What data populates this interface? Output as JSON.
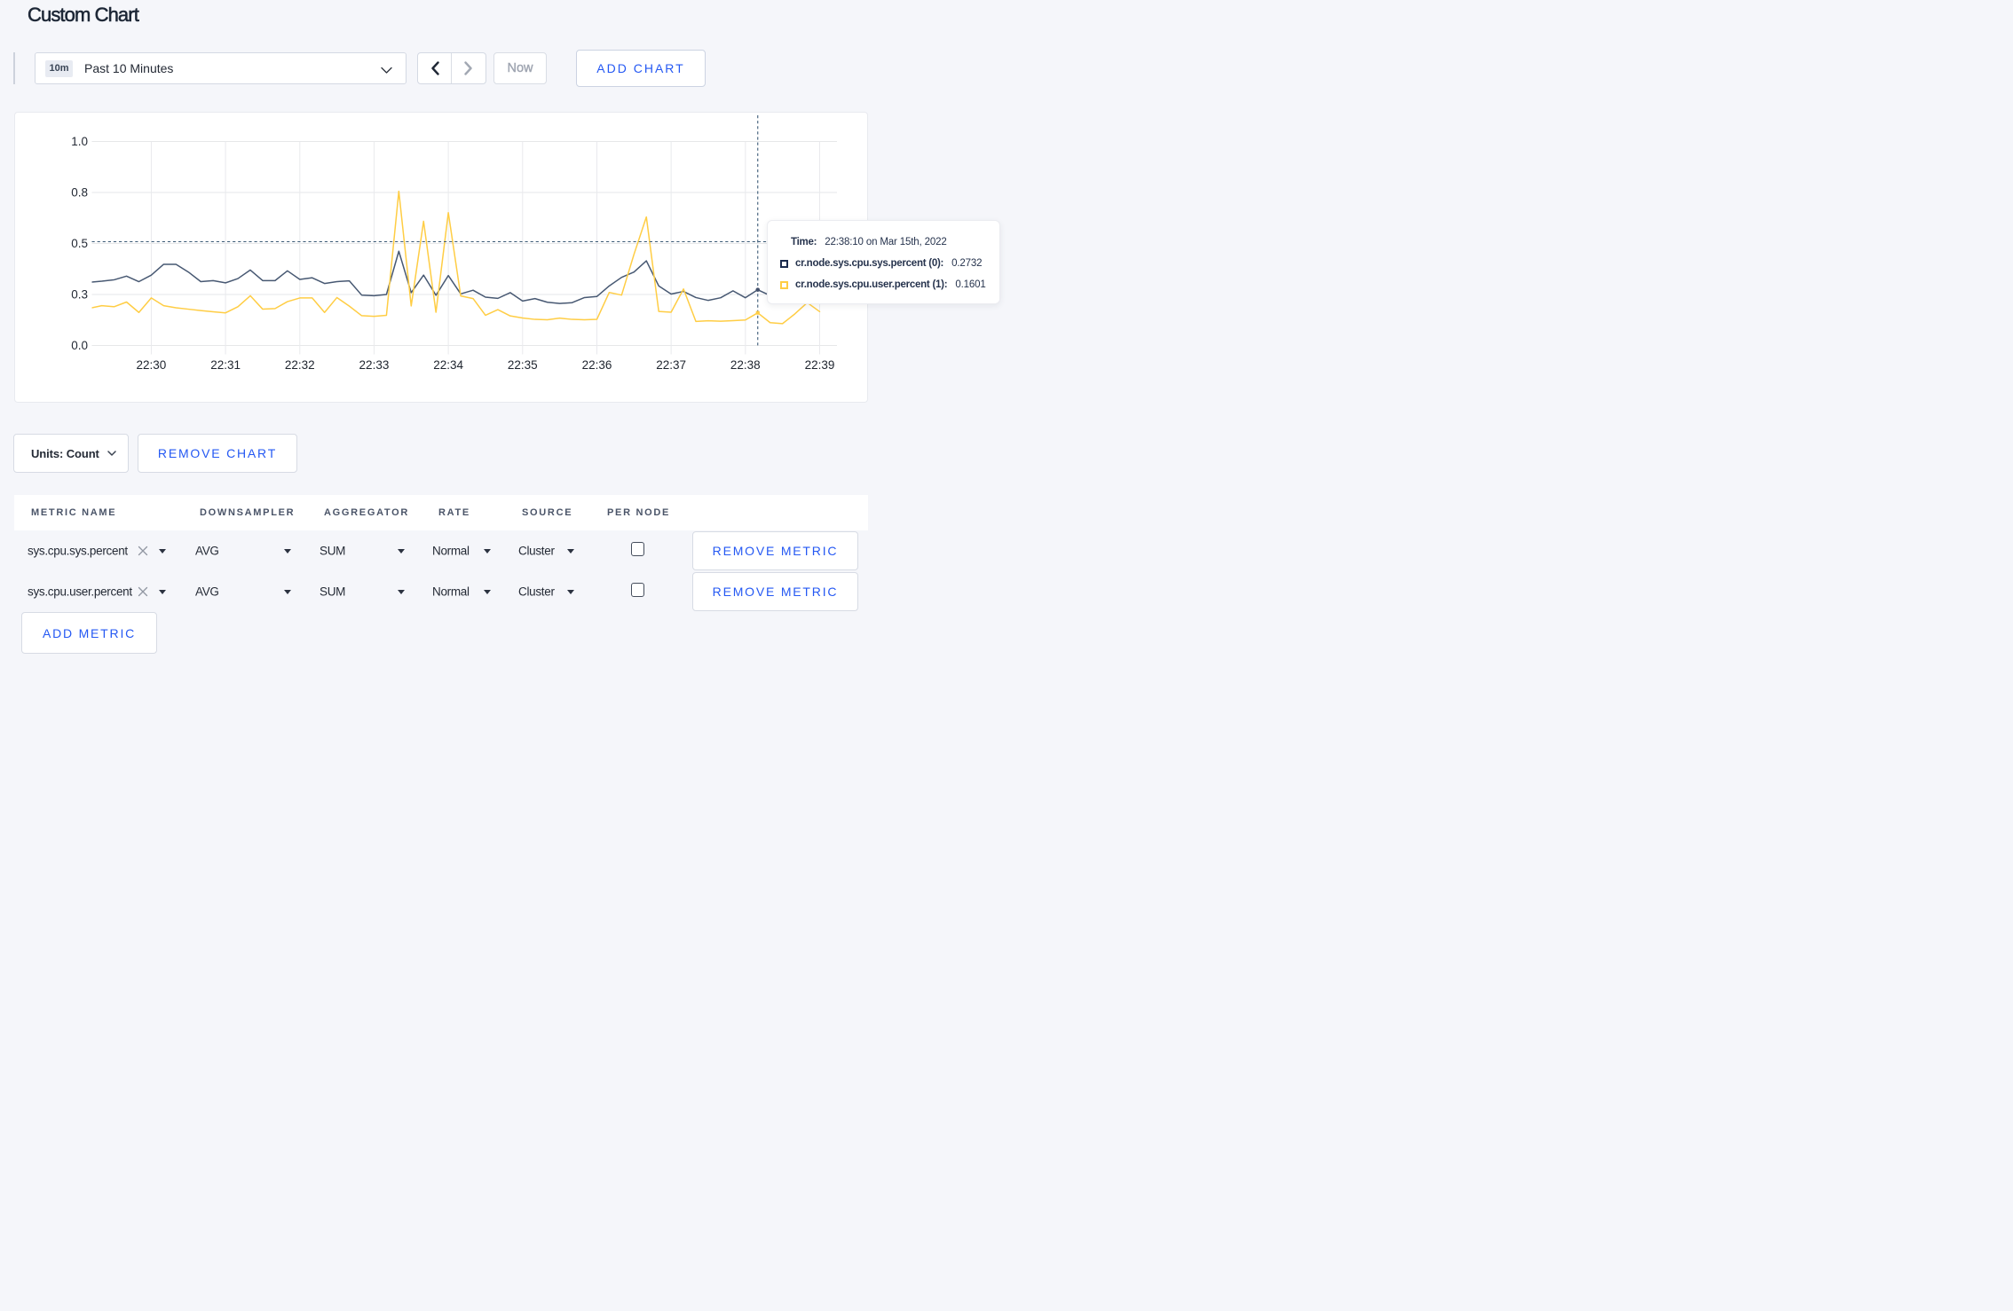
{
  "title": "Custom Chart",
  "toolbar": {
    "time_range_badge": "10m",
    "time_range_label": "Past 10 Minutes",
    "prev_icon": "chevron-left",
    "next_icon": "chevron-right",
    "now_label": "Now",
    "add_chart_label": "ADD CHART"
  },
  "chart_data": {
    "type": "line",
    "title": "",
    "xlabel": "",
    "ylabel": "",
    "ylim": [
      0,
      1.0
    ],
    "grid": true,
    "legend_position": "tooltip",
    "y_tick_labels": [
      "1.0",
      "0.8",
      "0.5",
      "0.3",
      "0.0"
    ],
    "y_tick_values": [
      1.0,
      0.75,
      0.5,
      0.25,
      0.0
    ],
    "x_tick_labels": [
      "22:30",
      "22:31",
      "22:32",
      "22:33",
      "22:34",
      "22:35",
      "22:36",
      "22:37",
      "22:38",
      "22:39"
    ],
    "x_domain": [
      "22:29:12",
      "22:39:14"
    ],
    "sample_interval_seconds": 10,
    "series": [
      {
        "name": "cr.node.sys.cpu.sys.percent (0)",
        "color": "#475872",
        "start_time": "22:29:10",
        "values": [
          0.31,
          0.315,
          0.322,
          0.34,
          0.313,
          0.345,
          0.398,
          0.398,
          0.36,
          0.313,
          0.318,
          0.307,
          0.328,
          0.37,
          0.318,
          0.318,
          0.366,
          0.324,
          0.332,
          0.304,
          0.313,
          0.317,
          0.247,
          0.244,
          0.25,
          0.462,
          0.259,
          0.345,
          0.246,
          0.343,
          0.253,
          0.271,
          0.237,
          0.231,
          0.259,
          0.218,
          0.23,
          0.212,
          0.206,
          0.21,
          0.235,
          0.24,
          0.292,
          0.334,
          0.36,
          0.415,
          0.292,
          0.252,
          0.265,
          0.235,
          0.221,
          0.234,
          0.268,
          0.234,
          0.2732,
          0.245,
          0.238,
          0.255,
          0.248,
          0.24
        ]
      },
      {
        "name": "cr.node.sys.cpu.user.percent (1)",
        "color": "#FFCD44",
        "start_time": "22:29:10",
        "values": [
          0.182,
          0.195,
          0.19,
          0.213,
          0.162,
          0.233,
          0.195,
          0.185,
          0.178,
          0.171,
          0.165,
          0.16,
          0.19,
          0.244,
          0.178,
          0.181,
          0.215,
          0.233,
          0.233,
          0.162,
          0.235,
          0.193,
          0.146,
          0.143,
          0.148,
          0.756,
          0.194,
          0.609,
          0.163,
          0.651,
          0.243,
          0.23,
          0.148,
          0.176,
          0.145,
          0.135,
          0.128,
          0.126,
          0.134,
          0.128,
          0.126,
          0.128,
          0.26,
          0.247,
          0.447,
          0.63,
          0.167,
          0.163,
          0.277,
          0.118,
          0.121,
          0.119,
          0.122,
          0.125,
          0.1601,
          0.112,
          0.107,
          0.155,
          0.21,
          0.166
        ]
      }
    ],
    "crosshair": {
      "time": "22:38:10",
      "value_y": 0.5087
    }
  },
  "tooltip": {
    "time_label": "Time:",
    "time_value": "22:38:10 on Mar 15th, 2022",
    "rows": [
      {
        "name": "cr.node.sys.cpu.sys.percent (0):",
        "value": "0.2732",
        "color": "#1b2b4d"
      },
      {
        "name": "cr.node.sys.cpu.user.percent (1):",
        "value": "0.1601",
        "color": "#FFCD44"
      }
    ]
  },
  "colors": {
    "accent_blue": "#2458f3",
    "series_sys": "#475872",
    "series_user": "#FFCD44",
    "page_background": "#f5f6fa",
    "crosshair": "#3b5a76"
  },
  "controls": {
    "units_label": "Units: Count",
    "remove_chart_label": "REMOVE CHART",
    "add_metric_label": "ADD METRIC"
  },
  "table": {
    "headers": [
      "METRIC NAME",
      "DOWNSAMPLER",
      "AGGREGATOR",
      "RATE",
      "SOURCE",
      "PER NODE"
    ],
    "rows": [
      {
        "metric_name": "sys.cpu.sys.percent",
        "downsampler": "AVG",
        "aggregator": "SUM",
        "rate": "Normal",
        "source": "Cluster",
        "per_node_checked": false,
        "remove_label": "REMOVE METRIC"
      },
      {
        "metric_name": "sys.cpu.user.percent",
        "downsampler": "AVG",
        "aggregator": "SUM",
        "rate": "Normal",
        "source": "Cluster",
        "per_node_checked": false,
        "remove_label": "REMOVE METRIC"
      }
    ]
  }
}
